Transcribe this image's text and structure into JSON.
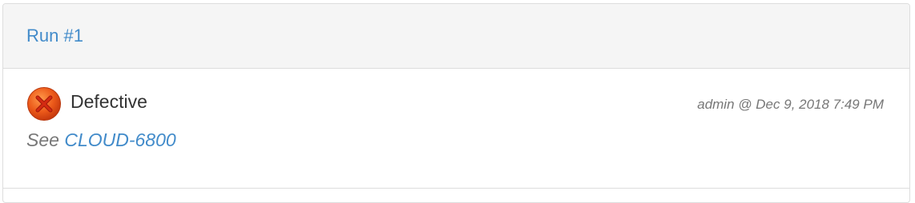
{
  "run": {
    "title": "Run #1"
  },
  "result": {
    "status_label": "Defective",
    "status_icon": "x-circle-icon",
    "status_color": "#e8541c",
    "author": "admin",
    "meta_separator": "@",
    "timestamp": "Dec 9, 2018 7:49 PM"
  },
  "comment": {
    "prefix": "See",
    "link_text": "CLOUD-6800"
  }
}
